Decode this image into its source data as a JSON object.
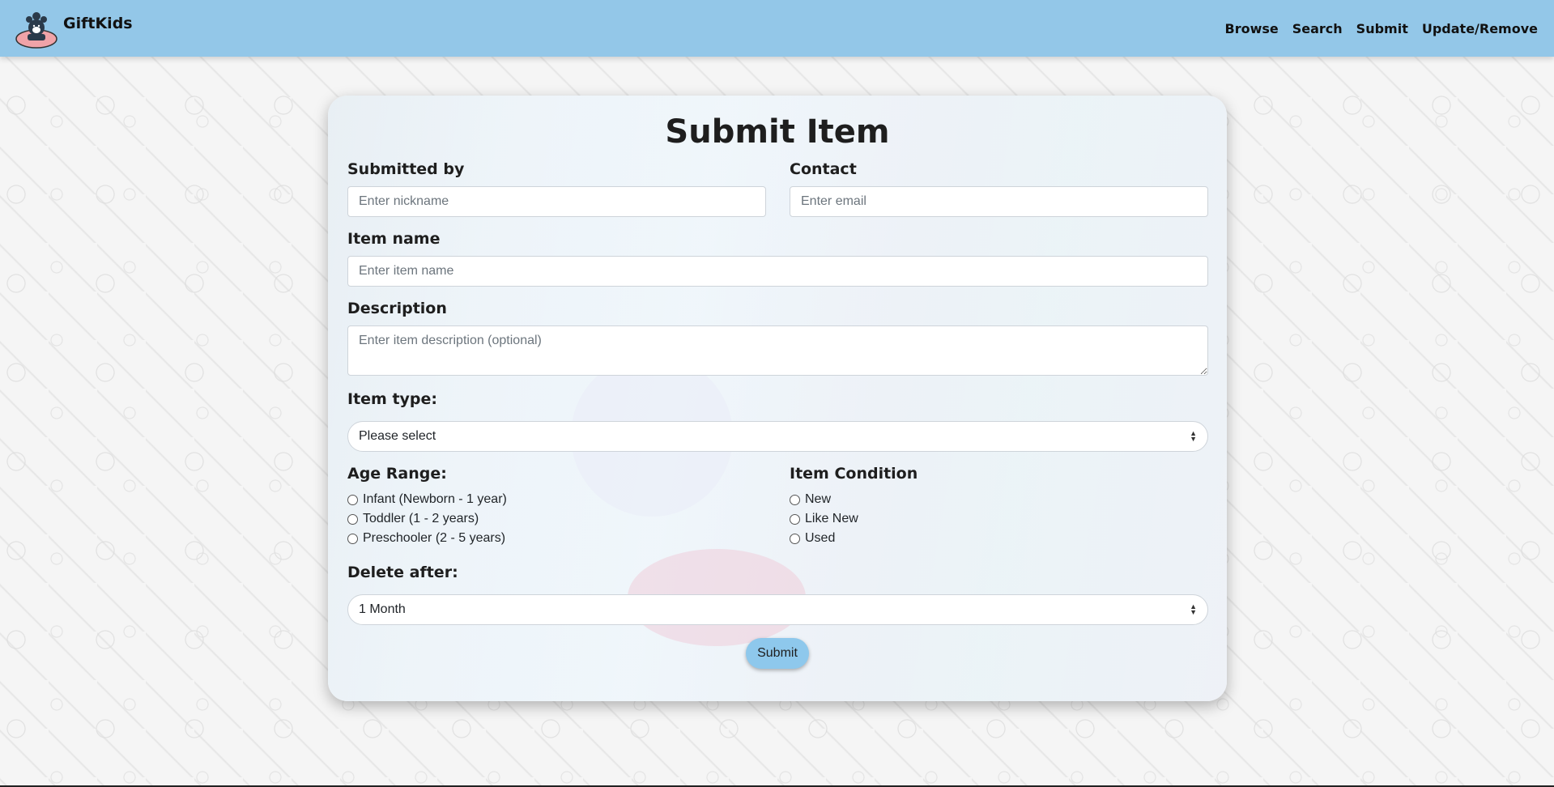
{
  "brand": {
    "name": "GiftKids",
    "logo_icon": "bear-logo-icon"
  },
  "nav": {
    "items": [
      "Browse",
      "Search",
      "Submit",
      "Update/Remove"
    ]
  },
  "form": {
    "title": "Submit Item",
    "submitted_by": {
      "label": "Submitted by",
      "placeholder": "Enter nickname"
    },
    "contact": {
      "label": "Contact",
      "placeholder": "Enter email"
    },
    "item_name": {
      "label": "Item name",
      "placeholder": "Enter item name"
    },
    "description": {
      "label": "Description",
      "placeholder": "Enter item description (optional)"
    },
    "item_type": {
      "label": "Item type:",
      "selected": "Please select"
    },
    "age_range": {
      "label": "Age Range:",
      "options": [
        "Infant (Newborn - 1 year)",
        "Toddler (1 - 2 years)",
        "Preschooler (2 - 5 years)"
      ]
    },
    "item_condition": {
      "label": "Item Condition",
      "options": [
        "New",
        "Like New",
        "Used"
      ]
    },
    "delete_after": {
      "label": "Delete after:",
      "selected": "1 Month"
    },
    "submit_label": "Submit"
  },
  "colors": {
    "navbar": "#93c7e8",
    "button": "#8ec8ec"
  }
}
